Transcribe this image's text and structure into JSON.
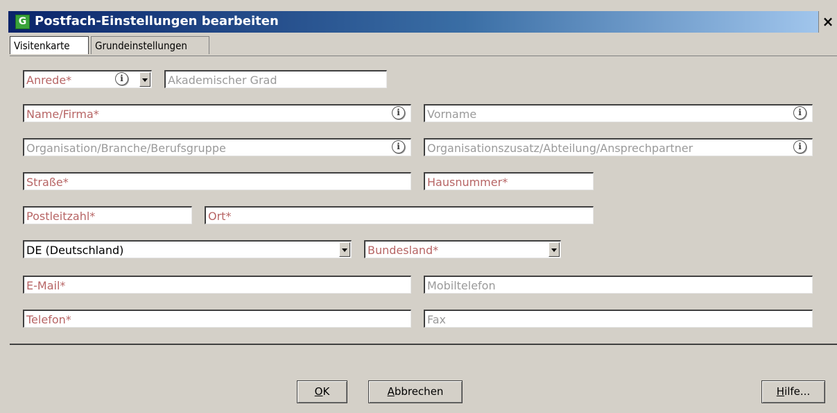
{
  "window": {
    "title": "Postfach-Einstellungen bearbeiten",
    "app_icon_letter": "G",
    "close_label": "×"
  },
  "tabs": [
    {
      "label": "Visitenkarte",
      "active": true
    },
    {
      "label": "Grundeinstellungen",
      "active": false
    }
  ],
  "form": {
    "anrede": {
      "placeholder": "Anrede*",
      "required": true
    },
    "akademischer_grad": {
      "placeholder": "Akademischer Grad"
    },
    "name_firma": {
      "placeholder": "Name/Firma*",
      "required": true
    },
    "vorname": {
      "placeholder": "Vorname"
    },
    "organisation": {
      "placeholder": "Organisation/Branche/Berufsgruppe"
    },
    "organisationszusatz": {
      "placeholder": "Organisationszusatz/Abteilung/Ansprechpartner"
    },
    "strasse": {
      "placeholder": "Straße*",
      "required": true
    },
    "hausnummer": {
      "placeholder": "Hausnummer*",
      "required": true
    },
    "postleitzahl": {
      "placeholder": "Postleitzahl*",
      "required": true
    },
    "ort": {
      "placeholder": "Ort*",
      "required": true
    },
    "land": {
      "value": "DE (Deutschland)"
    },
    "bundesland": {
      "placeholder": "Bundesland*",
      "required": true
    },
    "email": {
      "placeholder": "E-Mail*",
      "required": true
    },
    "mobiltelefon": {
      "placeholder": "Mobiltelefon"
    },
    "telefon": {
      "placeholder": "Telefon*",
      "required": true
    },
    "fax": {
      "placeholder": "Fax"
    },
    "info_symbol": "i"
  },
  "buttons": {
    "ok": {
      "mnemonic": "O",
      "rest": "K"
    },
    "abbrechen": {
      "mnemonic": "A",
      "rest": "bbrechen"
    },
    "hilfe": {
      "mnemonic": "H",
      "rest": "ilfe..."
    }
  },
  "colors": {
    "required_placeholder": "#b76565",
    "optional_placeholder": "#9a9a9a",
    "titlebar_start": "#0a246a",
    "titlebar_end": "#a6caf0"
  }
}
